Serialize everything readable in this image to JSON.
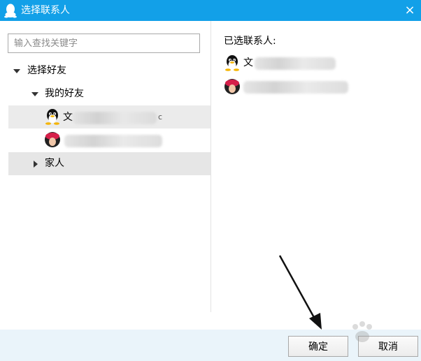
{
  "window": {
    "title": "选择联系人",
    "close_glyph": "×",
    "title_icon": "qq-penguin-icon"
  },
  "search": {
    "placeholder": "输入查找关键字",
    "value": ""
  },
  "tree": {
    "root_label": "选择好友",
    "groups": [
      {
        "label": "我的好友",
        "expanded": true
      },
      {
        "label": "家人",
        "expanded": false
      }
    ],
    "friends": [
      {
        "name_visible": "文",
        "name_tail": "c",
        "avatar": "penguin-avatar-icon"
      },
      {
        "name_visible": "",
        "name_tail": "",
        "avatar": "redhat-avatar-icon"
      }
    ]
  },
  "selected": {
    "title": "已选联系人:",
    "contacts": [
      {
        "name_visible": "文",
        "avatar": "penguin-avatar-icon"
      },
      {
        "name_visible": "",
        "avatar": "redhat-avatar-icon"
      }
    ]
  },
  "footer": {
    "ok_label": "确定",
    "cancel_label": "取消"
  },
  "colors": {
    "titlebar": "#12a0e8",
    "footer": "#eaf4fa",
    "row_selected": "#ebebeb"
  }
}
